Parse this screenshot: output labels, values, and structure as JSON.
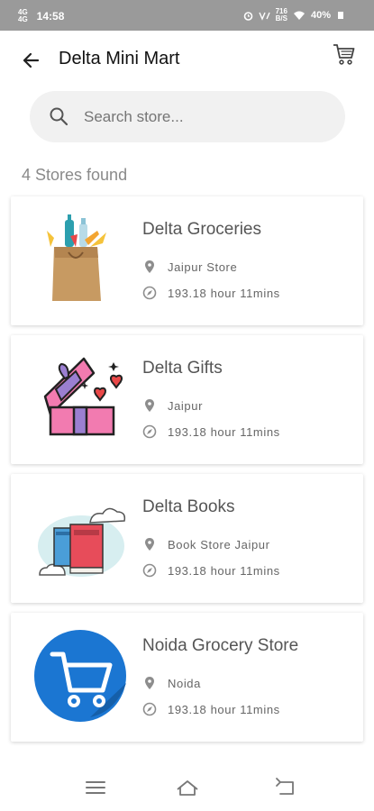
{
  "status_bar": {
    "signal_labels": [
      "4G",
      "4G"
    ],
    "time": "14:58",
    "network_speed": "716",
    "network_unit": "B/S",
    "battery": "40%"
  },
  "app_bar": {
    "title": "Delta Mini Mart"
  },
  "search": {
    "placeholder": "Search store..."
  },
  "results": {
    "count_text": "4 Stores found"
  },
  "stores": [
    {
      "name": "Delta Groceries",
      "location": "Jaipur Store",
      "time": "193.18 hour 11mins",
      "image": "grocery-bag"
    },
    {
      "name": "Delta Gifts",
      "location": "Jaipur",
      "time": "193.18 hour 11mins",
      "image": "gift-box"
    },
    {
      "name": "Delta Books",
      "location": "Book Store Jaipur",
      "time": "193.18 hour 11mins",
      "image": "books"
    },
    {
      "name": "Noida Grocery Store",
      "location": "Noida",
      "time": "193.18 hour 11mins",
      "image": "shopping-cart"
    }
  ],
  "nav_bar": {
    "buttons": [
      "menu",
      "home",
      "back"
    ]
  },
  "colors": {
    "status_bar": "#9a9a9a",
    "search_bg": "#f1f1f1",
    "cart_circle": "#1b76d2",
    "gift_pink": "#f27bb0",
    "gift_ribbon": "#9b7fd1"
  }
}
